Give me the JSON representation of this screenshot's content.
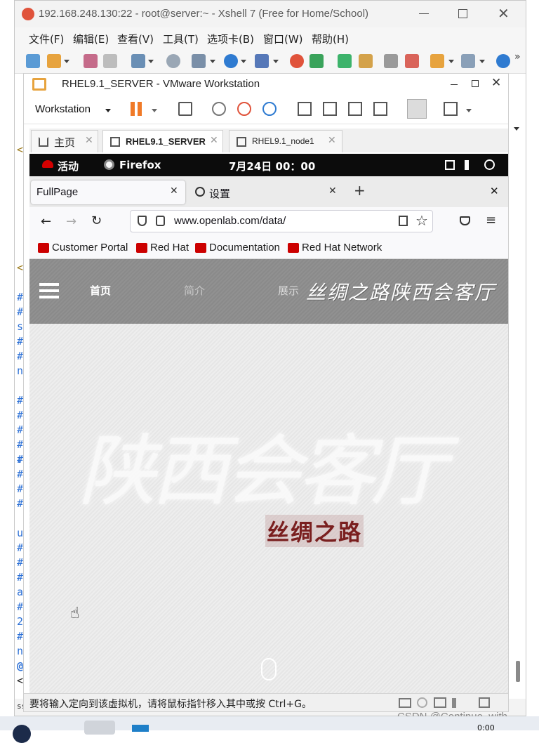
{
  "xshell": {
    "title": "192.168.248.130:22 - root@server:~ - Xshell 7 (Free for Home/School)",
    "menu": [
      "文件(F)",
      "编辑(E)",
      "查看(V)",
      "工具(T)",
      "选项卡(B)",
      "窗口(W)",
      "帮助(H)"
    ],
    "terminal_chars": [
      "<",
      "<",
      "#",
      "#",
      "s",
      "#",
      "#",
      "n",
      "#",
      "#",
      "#",
      "#",
      "#",
      "ra",
      "#",
      "#",
      "#",
      "u",
      "#",
      "#",
      "#",
      "ar",
      "#",
      "2",
      "#",
      "n",
      "@",
      "<e",
      "ss"
    ]
  },
  "vmware": {
    "title": "RHEL9.1_SERVER - VMware Workstation",
    "menu_label": "Workstation",
    "tabs": [
      {
        "label": "主页"
      },
      {
        "label": "RHEL9.1_SERVER"
      },
      {
        "label": "RHEL9.1_node1"
      }
    ],
    "status_text": "要将输入定向到该虚拟机，请将鼠标指针移入其中或按 Ctrl+G。"
  },
  "gnome": {
    "activities": "活动",
    "app": "Firefox",
    "clock": "7月24日  00：00"
  },
  "firefox": {
    "tabs": [
      {
        "label": "FullPage"
      },
      {
        "label": "设置"
      }
    ],
    "url": "www.openlab.com/data/",
    "bookmarks": [
      "Customer Portal",
      "Red Hat",
      "Documentation",
      "Red Hat Network"
    ]
  },
  "site": {
    "nav": [
      "首页",
      "简介",
      "展示"
    ],
    "logo_text": "丝绸之路陕西会客厅",
    "hero_calligraphy": "陕西会客厅",
    "hero_seal": "丝绸之路"
  },
  "watermark": "CSDN @Continue_with",
  "taskbar_time": "0:00",
  "colors": {
    "terminal_blue": "#2a6fd6",
    "redhat_red": "#cc0000",
    "seal_red": "#7a1f1f",
    "header_gray": "#8a8a8a"
  }
}
